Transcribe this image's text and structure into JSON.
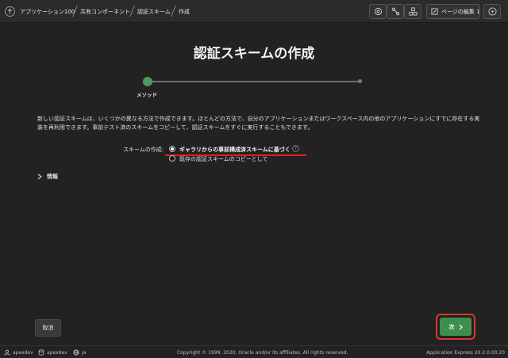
{
  "breadcrumb": {
    "items": [
      "アプリケーション100",
      "共有コンポーネント",
      "認証スキーム",
      "作成"
    ]
  },
  "toolbar": {
    "edit_page_label": "ページの編集 1",
    "icons": [
      "help-search-icon",
      "link-icon",
      "shared-components-icon",
      "run-icon"
    ]
  },
  "page": {
    "title": "認証スキームの作成"
  },
  "wizard": {
    "steps": [
      "メソッド"
    ],
    "active_step": 1
  },
  "description": "新しい認証スキームは、いくつかの異なる方法で作成できます。ほとんどの方法で、自分のアプリケーションまたはワークスペース内の他のアプリケーションにすでに存在する実装を再利用できます。事前テスト済のスキームをコピーして、認証スキームをすぐに実行することもできます。",
  "form": {
    "label": "スキームの作成:",
    "options": [
      {
        "label": "ギャラリからの事前構成済スキームに基づく",
        "selected": true
      },
      {
        "label": "既存の認証スキームのコピーとして",
        "selected": false
      }
    ]
  },
  "info_section": {
    "label": "情報"
  },
  "buttons": {
    "cancel": "取消",
    "next": "次"
  },
  "footer": {
    "user": "apexdev",
    "workspace": "apexdev",
    "language": "ja",
    "copyright": "Copyright © 1999, 2020, Oracle and/or its affiliates. All rights reserved.",
    "version": "Application Express 20.2.0.00.20"
  },
  "colors": {
    "accent_green": "#3e8e4f",
    "highlight_red": "#e0352b",
    "background": "#222222"
  }
}
